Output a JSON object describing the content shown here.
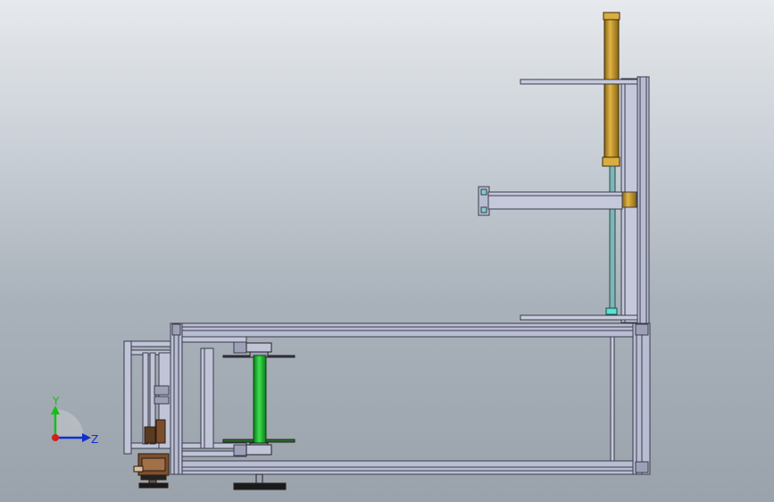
{
  "viewport": {
    "background_top": "#e6e9ed",
    "background_bottom": "#9aa2ab"
  },
  "colors": {
    "frame": "#b9bdd3",
    "frame_edge": "#3a3c4a",
    "cylinder_gold": "#c99a2e",
    "green_roller": "#1fb830",
    "teal_rod": "#7fb5b5",
    "brown_parts": "#6e4a30"
  },
  "triad": {
    "y_label": "Y",
    "z_label": "Z",
    "y_color": "#16c016",
    "z_color": "#1030d0",
    "x_color": "#d02020"
  }
}
